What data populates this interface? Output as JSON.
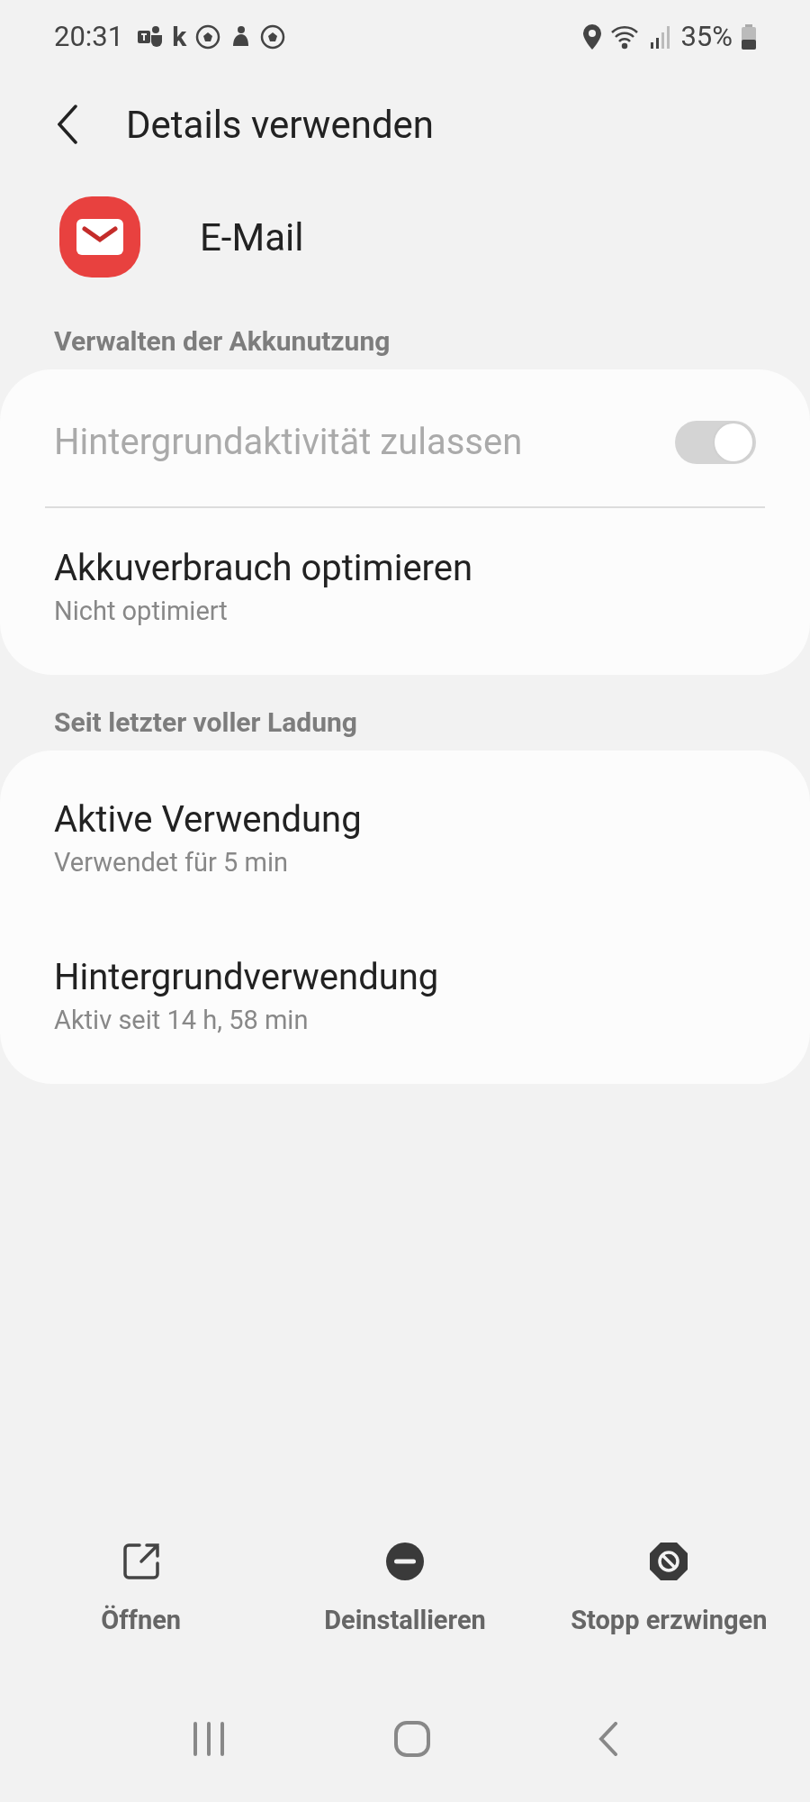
{
  "status_bar": {
    "time": "20:31",
    "notifications": [
      {
        "kind": "teams"
      },
      {
        "kind": "letter",
        "text": "k"
      },
      {
        "kind": "ball"
      },
      {
        "kind": "figure"
      },
      {
        "kind": "ball"
      }
    ],
    "battery": "35%"
  },
  "header": {
    "title": "Details verwenden"
  },
  "app": {
    "name": "E-Mail"
  },
  "sections": [
    {
      "label": "Verwalten der Akkunutzung",
      "rows": [
        {
          "kind": "toggle",
          "title": "Hintergrundaktivität zulassen",
          "on": true,
          "disabled": true
        },
        {
          "kind": "text",
          "title": "Akkuverbrauch optimieren",
          "subtitle": "Nicht optimiert"
        }
      ]
    },
    {
      "label": "Seit letzter voller Ladung",
      "rows": [
        {
          "kind": "text",
          "title": "Aktive Verwendung",
          "subtitle": "Verwendet für 5 min"
        },
        {
          "kind": "text",
          "title": "Hintergrundverwendung",
          "subtitle": "Aktiv seit 14 h, 58 min"
        }
      ]
    }
  ],
  "actions": [
    {
      "kind": "open",
      "label": "Öffnen"
    },
    {
      "kind": "uninstall",
      "label": "Deinstallieren"
    },
    {
      "kind": "stop",
      "label": "Stopp erzwingen"
    }
  ]
}
